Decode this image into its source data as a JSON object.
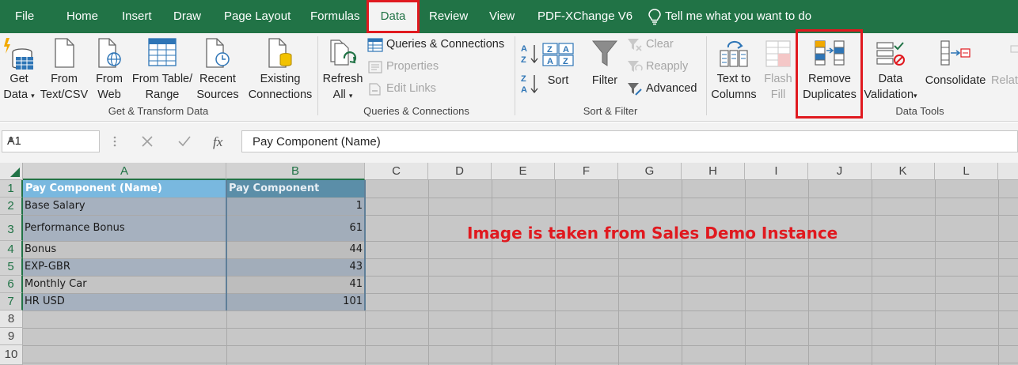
{
  "tabs": [
    {
      "label": "File"
    },
    {
      "label": "Home"
    },
    {
      "label": "Insert"
    },
    {
      "label": "Draw"
    },
    {
      "label": "Page Layout"
    },
    {
      "label": "Formulas"
    },
    {
      "label": "Data"
    },
    {
      "label": "Review"
    },
    {
      "label": "View"
    },
    {
      "label": "PDF-XChange V6"
    }
  ],
  "tell_me": "Tell me what you want to do",
  "ribbon": {
    "get_transform": {
      "get_data": [
        "Get",
        "Data"
      ],
      "from_text_csv": [
        "From",
        "Text/CSV"
      ],
      "from_web": [
        "From",
        "Web"
      ],
      "from_table_range": [
        "From Table/",
        "Range"
      ],
      "recent_sources": [
        "Recent",
        "Sources"
      ],
      "existing_connections": [
        "Existing",
        "Connections"
      ],
      "group_label": "Get & Transform Data"
    },
    "queries": {
      "refresh_all": [
        "Refresh",
        "All"
      ],
      "queries_connections": "Queries & Connections",
      "properties": "Properties",
      "edit_links": "Edit Links",
      "group_label": "Queries & Connections"
    },
    "sort_filter": {
      "sort": "Sort",
      "filter": "Filter",
      "clear": "Clear",
      "reapply": "Reapply",
      "advanced": "Advanced",
      "group_label": "Sort & Filter"
    },
    "data_tools": {
      "text_to_columns": [
        "Text to",
        "Columns"
      ],
      "flash_fill": [
        "Flash",
        "Fill"
      ],
      "remove_duplicates": [
        "Remove",
        "Duplicates"
      ],
      "data_validation": [
        "Data",
        "Validation"
      ],
      "consolidate": "Consolidate",
      "relationships": "Relati",
      "group_label": "Data Tools"
    }
  },
  "formula_bar": {
    "name_box": "A1",
    "content": "Pay Component (Name)"
  },
  "columns": [
    "A",
    "B",
    "C",
    "D",
    "E",
    "F",
    "G",
    "H",
    "I",
    "J",
    "K",
    "L"
  ],
  "rows": [
    "1",
    "2",
    "3",
    "4",
    "5",
    "6",
    "7",
    "8",
    "9",
    "10"
  ],
  "table": {
    "headers": [
      "Pay Component (Name)",
      "Pay Component"
    ],
    "rows": [
      [
        "Base Salary",
        "1"
      ],
      [
        "Performance Bonus",
        "61"
      ],
      [
        "Bonus",
        "44"
      ],
      [
        "EXP-GBR",
        "43"
      ],
      [
        "Monthly Car",
        "41"
      ],
      [
        "HR USD",
        "101"
      ]
    ]
  },
  "annotation": "Image is taken from Sales Demo Instance",
  "colors": {
    "excel_green": "#217346",
    "highlight_red": "#e0191f"
  }
}
